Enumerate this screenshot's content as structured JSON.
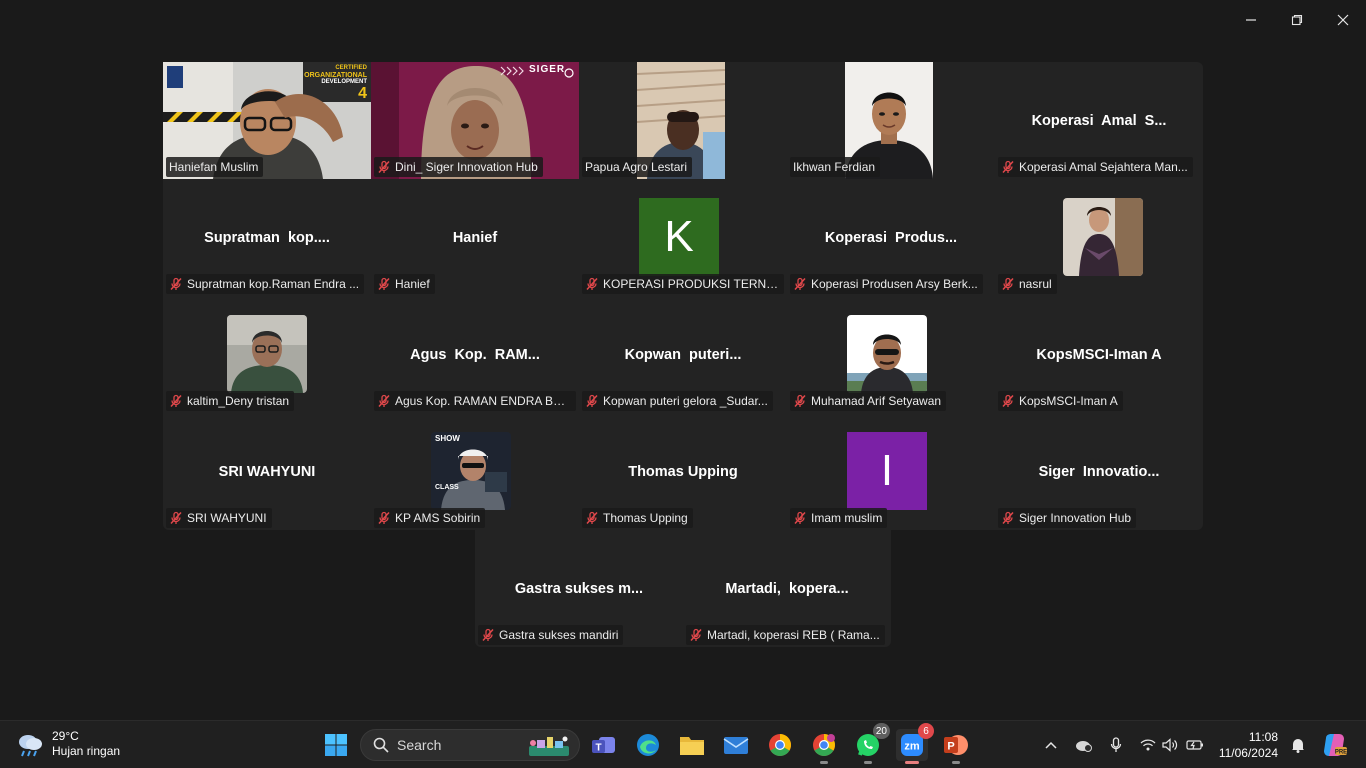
{
  "participants": [
    {
      "name": "Haniefan Muslim",
      "muted": false,
      "type": "video",
      "active": true
    },
    {
      "name": "Dini_ Siger Innovation Hub",
      "muted": true,
      "type": "video"
    },
    {
      "name": "Papua Agro Lestari",
      "muted": false,
      "type": "video"
    },
    {
      "name": "Ikhwan Ferdian",
      "muted": false,
      "type": "video"
    },
    {
      "name": "Koperasi Amal Sejahtera Man...",
      "muted": true,
      "type": "name",
      "display": "Koperasi  Amal  S..."
    },
    {
      "name": "Supratman  kop.Raman Endra ...",
      "muted": true,
      "type": "name",
      "display": "Supratman  kop...."
    },
    {
      "name": "Hanief",
      "muted": true,
      "type": "name",
      "display": "Hanief"
    },
    {
      "name": "KOPERASI PRODUKSI TERNAK...",
      "muted": true,
      "type": "letter",
      "letter": "K",
      "color": "#2e6b1f"
    },
    {
      "name": "Koperasi Produsen Arsy Berk...",
      "muted": true,
      "type": "name",
      "display": "Koperasi  Produs..."
    },
    {
      "name": "nasrul",
      "muted": true,
      "type": "photo"
    },
    {
      "name": "kaltim_Deny tristan",
      "muted": true,
      "type": "photo"
    },
    {
      "name": "Agus Kop. RAMAN ENDRA BE...",
      "muted": true,
      "type": "name",
      "display": "Agus  Kop.  RAM..."
    },
    {
      "name": "Kopwan puteri gelora _Sudar...",
      "muted": true,
      "type": "name",
      "display": "Kopwan  puteri..."
    },
    {
      "name": "Muhamad Arif Setyawan",
      "muted": true,
      "type": "photo"
    },
    {
      "name": "KopsMSCI-Iman A",
      "muted": true,
      "type": "name",
      "display": "KopsMSCI-Iman A"
    },
    {
      "name": "SRI WAHYUNI",
      "muted": true,
      "type": "name",
      "display": "SRI WAHYUNI"
    },
    {
      "name": "KP AMS Sobirin",
      "muted": true,
      "type": "photo",
      "photo_text": [
        "SHOW",
        "CLASS"
      ]
    },
    {
      "name": "Thomas Upping",
      "muted": true,
      "type": "name",
      "display": "Thomas Upping"
    },
    {
      "name": "Imam muslim",
      "muted": true,
      "type": "letter",
      "letter": "I",
      "color": "#7b21a6"
    },
    {
      "name": "Siger Innovation Hub",
      "muted": true,
      "type": "name",
      "display": "Siger  Innovatio..."
    },
    {
      "name": "Gastra sukses mandiri",
      "muted": true,
      "type": "name",
      "display": "Gastra sukses m..."
    },
    {
      "name": "Martadi, koperasi REB ( Rama...",
      "muted": true,
      "type": "name",
      "display": "Martadi,  kopera..."
    }
  ],
  "video_overlays": {
    "hanief_banner": [
      "CERTIFIED",
      "ORGANIZATIONAL",
      "DEVELOPMENT",
      "4"
    ],
    "dini_logo": "SIGER"
  },
  "taskbar": {
    "weather_temp": "29°C",
    "weather_desc": "Hujan ringan",
    "search_label": "Search",
    "whatsapp_badge": "20",
    "zoom_badge": "6",
    "time": "11:08",
    "date": "11/06/2024"
  },
  "colors": {
    "active_speaker": "#3fd69a",
    "muted_icon": "#e0484b",
    "tile_bg": "#232323"
  }
}
